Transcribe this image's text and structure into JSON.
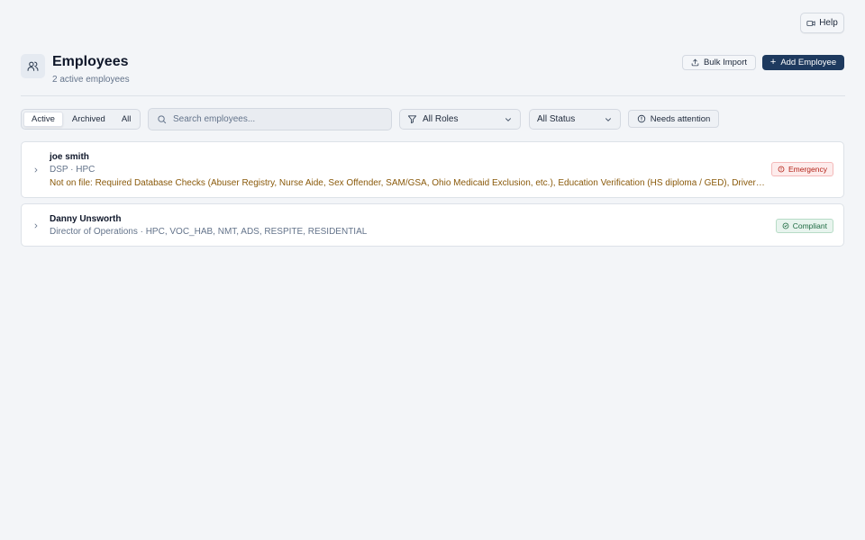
{
  "header": {
    "help_label": "Help",
    "title": "Employees",
    "subtitle": "2 active employees",
    "bulk_import_label": "Bulk Import",
    "add_employee_label": "Add Employee"
  },
  "filters": {
    "tabs": [
      {
        "label": "Active",
        "active": true
      },
      {
        "label": "Archived",
        "active": false
      },
      {
        "label": "All",
        "active": false
      }
    ],
    "search_placeholder": "Search employees...",
    "search_value": "",
    "roles_selected": "All Roles",
    "status_selected": "All Status",
    "needs_attention_label": "Needs attention"
  },
  "employees": [
    {
      "name": "joe smith",
      "meta": "DSP · HPC",
      "warning": "Not on file: Required Database Checks (Abuser Registry, Nurse Aide, Sex Offender, SAM/GSA, Ohio Medicaid Exclusion, etc.), Education Verification (HS diploma / GED), Driver License, Auto Insurance",
      "badge": "Emergency"
    },
    {
      "name": "Danny Unsworth",
      "meta": "Director of Operations · HPC, VOC_HAB, NMT, ADS, RESPITE, RESIDENTIAL",
      "badge": "Compliant"
    }
  ],
  "colors": {
    "primary": "#1e3a5f",
    "emergency": "#b42318",
    "compliant": "#1f6b43",
    "warning_text": "#8a5a0b"
  },
  "icons": {
    "help": "video-icon",
    "page": "users-icon",
    "bulk_import": "upload-icon",
    "add": "plus-icon",
    "search": "search-icon",
    "roles": "filter-icon",
    "attention": "alert-circle-icon",
    "row": "chevron-right-icon",
    "emergency": "alert-circle-icon",
    "compliant": "check-circle-icon"
  }
}
